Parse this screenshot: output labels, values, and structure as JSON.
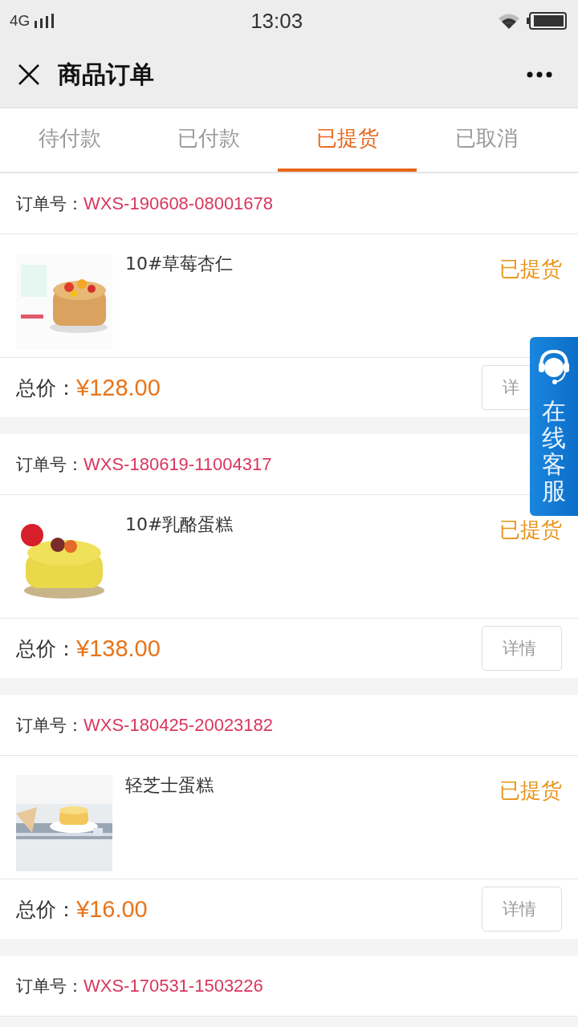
{
  "status_bar": {
    "network": "4G",
    "time": "13:03"
  },
  "nav": {
    "title": "商品订单"
  },
  "tabs": [
    {
      "label": "待付款",
      "selected": false
    },
    {
      "label": "已付款",
      "selected": false
    },
    {
      "label": "已提货",
      "selected": true
    },
    {
      "label": "已取消",
      "selected": false
    }
  ],
  "orders": [
    {
      "order_label": "订单号：",
      "order_no": "WXS-190608-08001678",
      "product": "10#草莓杏仁",
      "status": "已提货",
      "total_label": "总价：",
      "total": "¥128.00",
      "button": "详"
    },
    {
      "order_label": "订单号：",
      "order_no": "WXS-180619-11004317",
      "product": "10#乳酪蛋糕",
      "status": "已提货",
      "total_label": "总价：",
      "total": "¥138.00",
      "button": "详情"
    },
    {
      "order_label": "订单号：",
      "order_no": "WXS-180425-20023182",
      "product": "轻芝士蛋糕",
      "status": "已提货",
      "total_label": "总价：",
      "total": "¥16.00",
      "button": "详情"
    },
    {
      "order_label": "订单号：",
      "order_no": "WXS-170531-1503226"
    }
  ],
  "float_service": {
    "label": "在线客服"
  }
}
